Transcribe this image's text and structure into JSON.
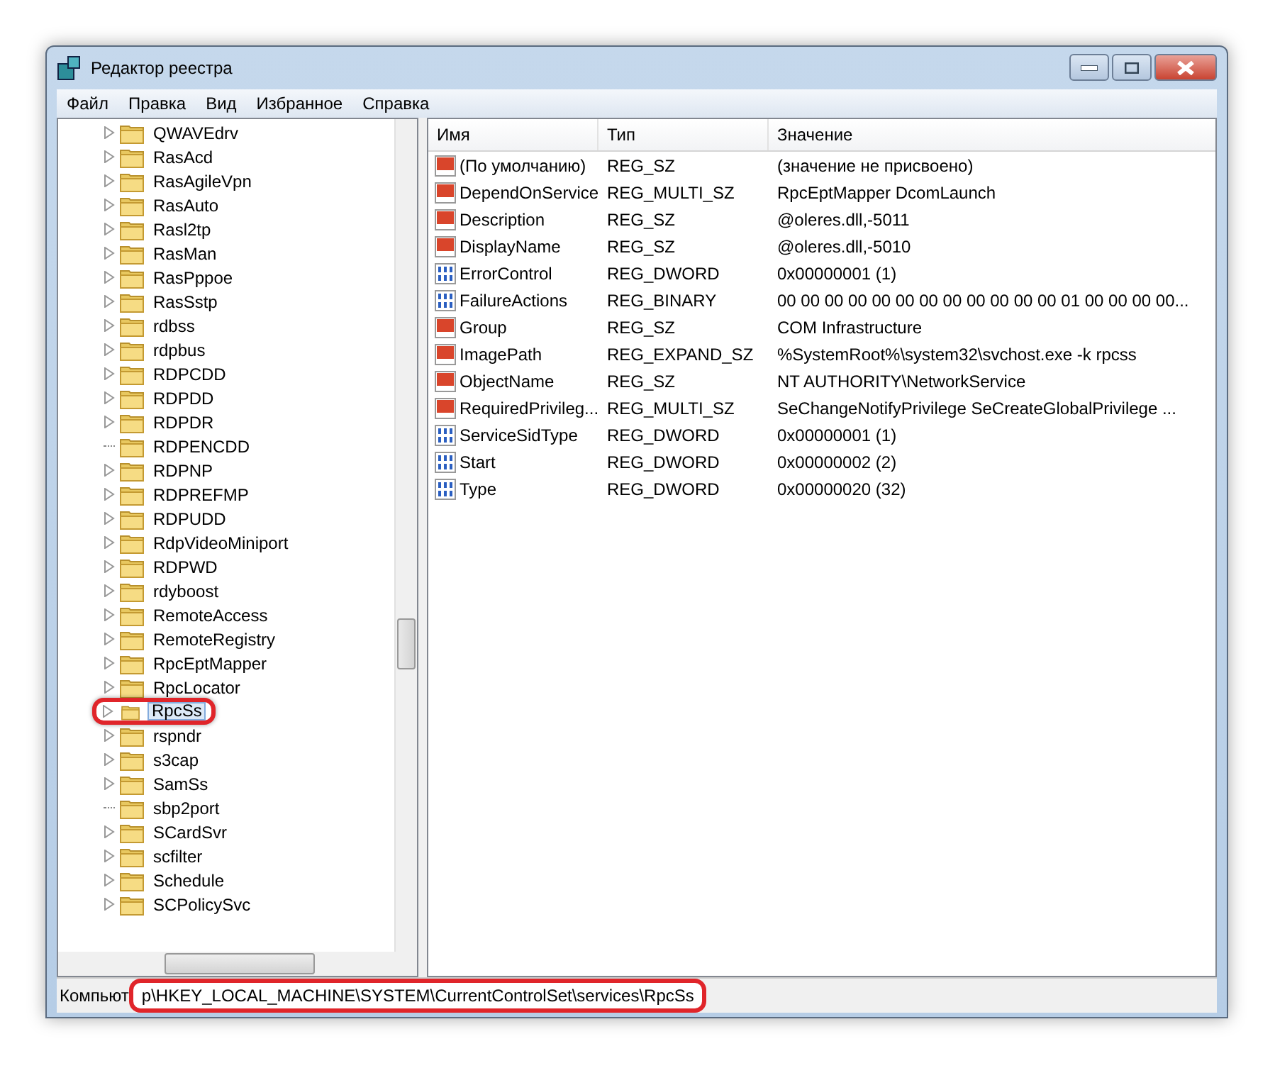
{
  "window": {
    "title": "Редактор реестра"
  },
  "menu": [
    "Файл",
    "Правка",
    "Вид",
    "Избранное",
    "Справка"
  ],
  "tree": [
    {
      "label": "QWAVEdrv",
      "expandable": true,
      "selected": false
    },
    {
      "label": "RasAcd",
      "expandable": true,
      "selected": false
    },
    {
      "label": "RasAgileVpn",
      "expandable": true,
      "selected": false
    },
    {
      "label": "RasAuto",
      "expandable": true,
      "selected": false
    },
    {
      "label": "Rasl2tp",
      "expandable": true,
      "selected": false
    },
    {
      "label": "RasMan",
      "expandable": true,
      "selected": false
    },
    {
      "label": "RasPppoe",
      "expandable": true,
      "selected": false
    },
    {
      "label": "RasSstp",
      "expandable": true,
      "selected": false
    },
    {
      "label": "rdbss",
      "expandable": true,
      "selected": false
    },
    {
      "label": "rdpbus",
      "expandable": true,
      "selected": false
    },
    {
      "label": "RDPCDD",
      "expandable": true,
      "selected": false
    },
    {
      "label": "RDPDD",
      "expandable": true,
      "selected": false
    },
    {
      "label": "RDPDR",
      "expandable": true,
      "selected": false
    },
    {
      "label": "RDPENCDD",
      "expandable": false,
      "selected": false
    },
    {
      "label": "RDPNP",
      "expandable": true,
      "selected": false
    },
    {
      "label": "RDPREFMP",
      "expandable": true,
      "selected": false
    },
    {
      "label": "RDPUDD",
      "expandable": true,
      "selected": false
    },
    {
      "label": "RdpVideoMiniport",
      "expandable": true,
      "selected": false
    },
    {
      "label": "RDPWD",
      "expandable": true,
      "selected": false
    },
    {
      "label": "rdyboost",
      "expandable": true,
      "selected": false
    },
    {
      "label": "RemoteAccess",
      "expandable": true,
      "selected": false
    },
    {
      "label": "RemoteRegistry",
      "expandable": true,
      "selected": false
    },
    {
      "label": "RpcEptMapper",
      "expandable": true,
      "selected": false
    },
    {
      "label": "RpcLocator",
      "expandable": true,
      "selected": false
    },
    {
      "label": "RpcSs",
      "expandable": true,
      "selected": true
    },
    {
      "label": "rspndr",
      "expandable": true,
      "selected": false
    },
    {
      "label": "s3cap",
      "expandable": true,
      "selected": false
    },
    {
      "label": "SamSs",
      "expandable": true,
      "selected": false
    },
    {
      "label": "sbp2port",
      "expandable": false,
      "selected": false
    },
    {
      "label": "SCardSvr",
      "expandable": true,
      "selected": false
    },
    {
      "label": "scfilter",
      "expandable": true,
      "selected": false
    },
    {
      "label": "Schedule",
      "expandable": true,
      "selected": false
    },
    {
      "label": "SCPolicySvc",
      "expandable": true,
      "selected": false
    }
  ],
  "table": {
    "columns": [
      "Имя",
      "Тип",
      "Значение"
    ],
    "rows": [
      {
        "kind": "string",
        "name": "(По умолчанию)",
        "type": "REG_SZ",
        "value": "(значение не присвоено)"
      },
      {
        "kind": "string",
        "name": "DependOnService",
        "type": "REG_MULTI_SZ",
        "value": "RpcEptMapper DcomLaunch"
      },
      {
        "kind": "string",
        "name": "Description",
        "type": "REG_SZ",
        "value": "@oleres.dll,-5011"
      },
      {
        "kind": "string",
        "name": "DisplayName",
        "type": "REG_SZ",
        "value": "@oleres.dll,-5010"
      },
      {
        "kind": "binary",
        "name": "ErrorControl",
        "type": "REG_DWORD",
        "value": "0x00000001 (1)"
      },
      {
        "kind": "binary",
        "name": "FailureActions",
        "type": "REG_BINARY",
        "value": "00 00 00 00 00 00 00 00 00 00 00 00 01 00 00 00 00..."
      },
      {
        "kind": "string",
        "name": "Group",
        "type": "REG_SZ",
        "value": "COM Infrastructure"
      },
      {
        "kind": "string",
        "name": "ImagePath",
        "type": "REG_EXPAND_SZ",
        "value": "%SystemRoot%\\system32\\svchost.exe -k rpcss"
      },
      {
        "kind": "string",
        "name": "ObjectName",
        "type": "REG_SZ",
        "value": "NT AUTHORITY\\NetworkService"
      },
      {
        "kind": "string",
        "name": "RequiredPrivileg...",
        "type": "REG_MULTI_SZ",
        "value": "SeChangeNotifyPrivilege SeCreateGlobalPrivilege ..."
      },
      {
        "kind": "binary",
        "name": "ServiceSidType",
        "type": "REG_DWORD",
        "value": "0x00000001 (1)"
      },
      {
        "kind": "binary",
        "name": "Start",
        "type": "REG_DWORD",
        "value": "0x00000002 (2)"
      },
      {
        "kind": "binary",
        "name": "Type",
        "type": "REG_DWORD",
        "value": "0x00000020 (32)"
      }
    ]
  },
  "status_bar": {
    "prefix": "Компьют",
    "path": "р\\HKEY_LOCAL_MACHINE\\SYSTEM\\CurrentControlSet\\services\\RpcSs"
  }
}
